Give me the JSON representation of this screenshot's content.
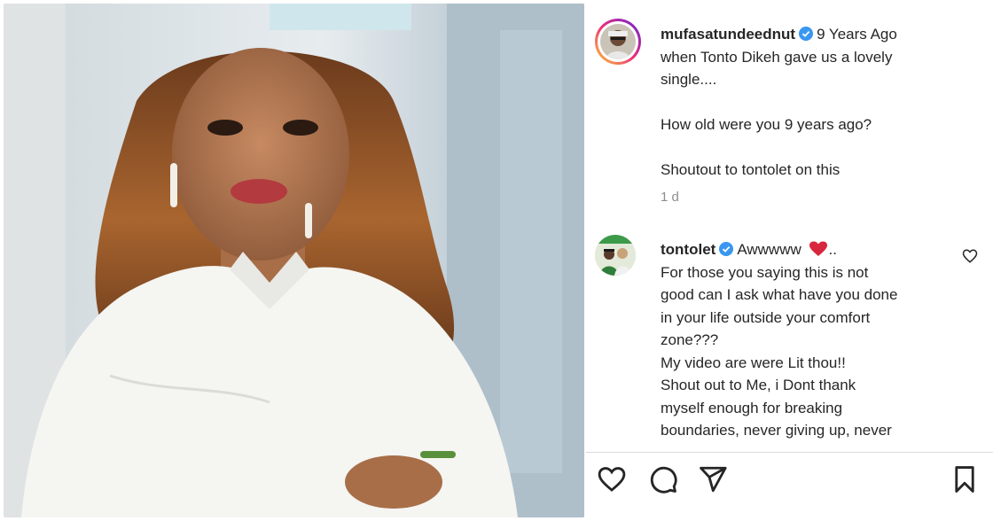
{
  "post": {
    "author": "mufasatundeednut",
    "caption_lines": [
      "9 Years Ago",
      "when Tonto Dikeh gave us a lovely",
      "single....",
      "",
      "How old were you 9 years ago?",
      "",
      "Shoutout to tontolet on this"
    ],
    "time": "1 d"
  },
  "comment": {
    "author": "tontolet",
    "first_text": "Awwwww",
    "after_heart": "..",
    "lines": [
      "For those you saying this is not",
      "good can I ask what have you done",
      "in your life outside your comfort",
      "zone???",
      "My video are were Lit thou!!",
      "Shout out to Me, i Dont thank",
      "myself enough for breaking",
      "boundaries, never giving up, never"
    ]
  },
  "icons": {
    "verified": "verified-badge-icon",
    "like": "heart-icon",
    "comment": "comment-icon",
    "share": "send-icon",
    "save": "bookmark-icon",
    "comment_like": "small-heart-icon",
    "emoji": "red-heart-emoji"
  },
  "colors": {
    "verified": "#3897f0",
    "text": "#262626",
    "muted": "#8e8e8e",
    "heart_emoji": "#d7263d"
  }
}
